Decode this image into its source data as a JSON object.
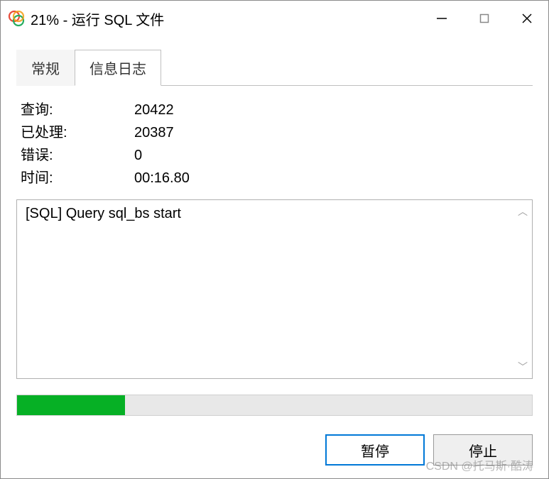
{
  "window": {
    "title": "21% - 运行 SQL 文件"
  },
  "tabs": {
    "general": "常规",
    "log": "信息日志",
    "active": "log"
  },
  "stats": {
    "query_label": "查询:",
    "query_value": "20422",
    "processed_label": "已处理:",
    "processed_value": "20387",
    "error_label": "错误:",
    "error_value": "0",
    "time_label": "时间:",
    "time_value": "00:16.80"
  },
  "log": {
    "text": "[SQL] Query sql_bs start"
  },
  "progress": {
    "percent": 21
  },
  "buttons": {
    "pause": "暂停",
    "stop": "停止"
  },
  "watermark": "CSDN @托马斯·酷涛"
}
